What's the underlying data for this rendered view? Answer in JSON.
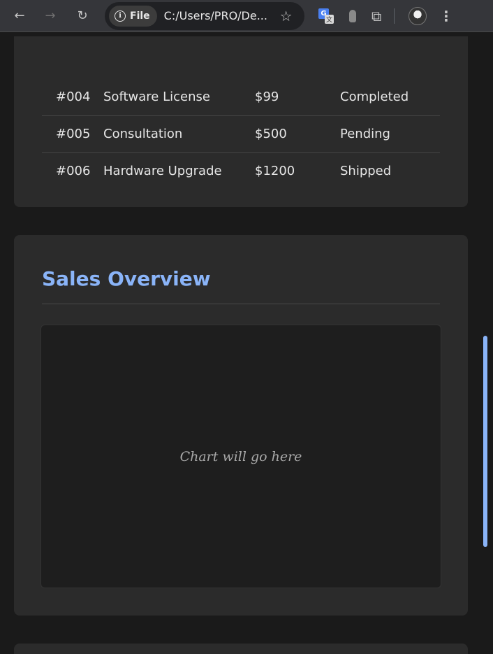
{
  "browser": {
    "chip_label": "File",
    "url": "C:/Users/PRO/De...",
    "icons": [
      "back-icon",
      "forward-icon",
      "reload-icon",
      "info-icon",
      "star-icon",
      "translate-icon",
      "extension-icon",
      "puzzle-icon",
      "avatar",
      "menu-icon"
    ]
  },
  "orders_table": {
    "rows": [
      {
        "id": "#004",
        "item": "Software License",
        "price": "$99",
        "status": "Completed"
      },
      {
        "id": "#005",
        "item": "Consultation",
        "price": "$500",
        "status": "Pending"
      },
      {
        "id": "#006",
        "item": "Hardware Upgrade",
        "price": "$1200",
        "status": "Shipped"
      }
    ]
  },
  "sales": {
    "title": "Sales Overview",
    "chart_placeholder": "Chart will go here"
  },
  "colors": {
    "accent": "#8ab4f8",
    "card_bg": "#2b2b2b",
    "page_bg": "#1a1a1a"
  }
}
